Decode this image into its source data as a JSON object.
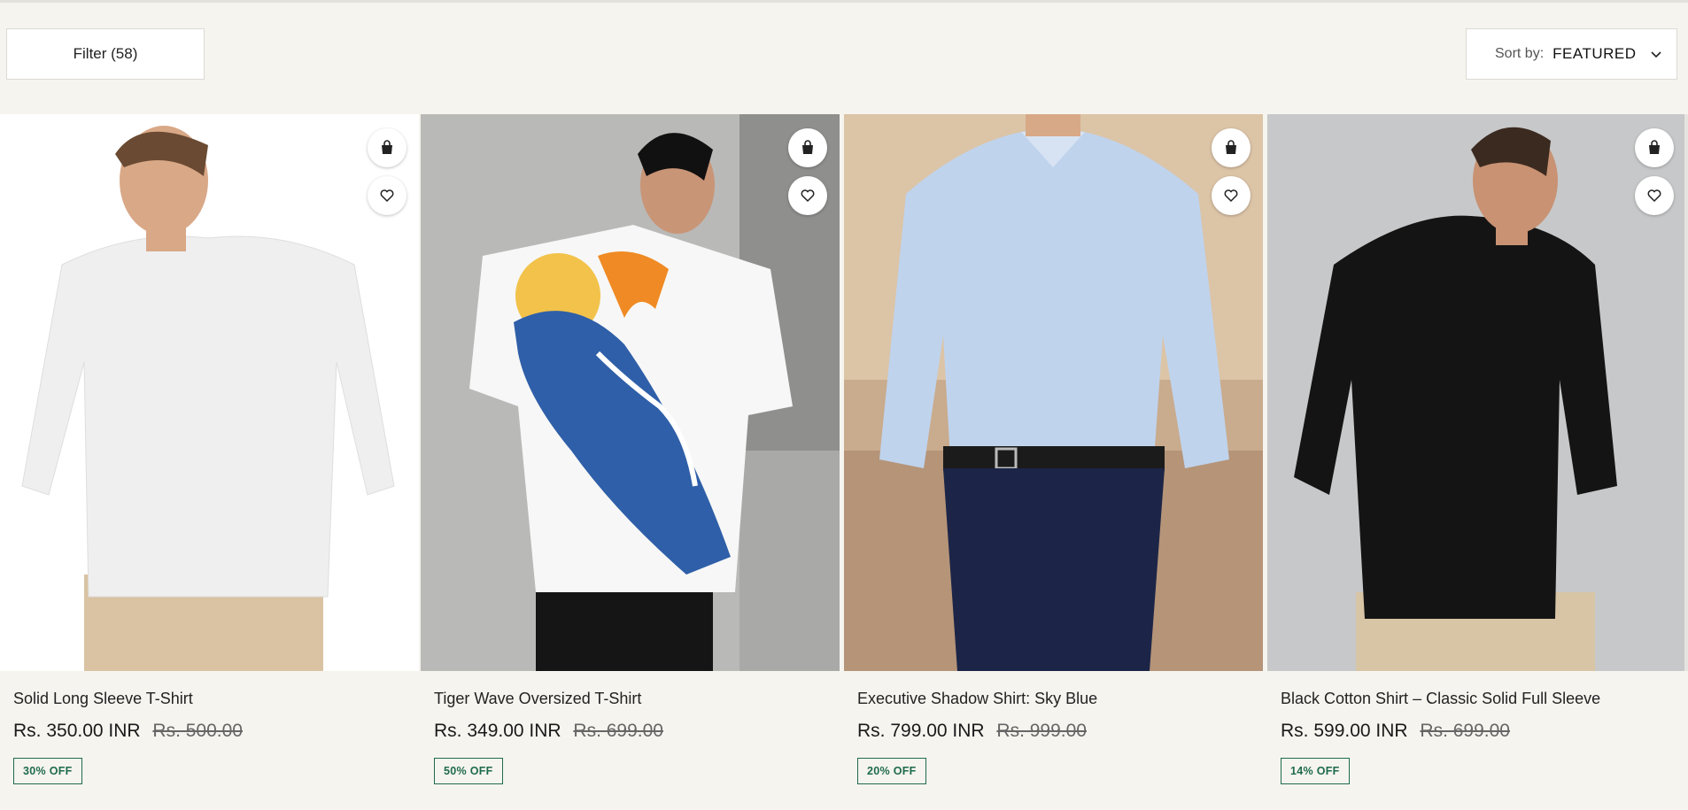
{
  "toolbar": {
    "filter_label": "Filter (58)",
    "sort_label": "Sort by:",
    "sort_value": "FEATURED"
  },
  "products": [
    {
      "title": "Solid Long Sleeve T-Shirt",
      "price": "Rs. 350.00 INR",
      "old_price": "Rs. 500.00",
      "badge": "30% OFF"
    },
    {
      "title": "Tiger Wave Oversized T-Shirt",
      "price": "Rs. 349.00 INR",
      "old_price": "Rs. 699.00",
      "badge": "50% OFF"
    },
    {
      "title": "Executive Shadow Shirt: Sky Blue",
      "price": "Rs. 799.00 INR",
      "old_price": "Rs. 999.00",
      "badge": "20% OFF"
    },
    {
      "title": "Black Cotton Shirt – Classic Solid Full Sleeve",
      "price": "Rs. 599.00 INR",
      "old_price": "Rs. 699.00",
      "badge": "14% OFF"
    }
  ],
  "icons": {
    "bag": "shopping-bag-icon",
    "heart": "heart-icon",
    "chevron": "chevron-down-icon"
  },
  "colors": {
    "page_bg": "#f6f4ef",
    "badge_green": "#1e6b4c"
  }
}
